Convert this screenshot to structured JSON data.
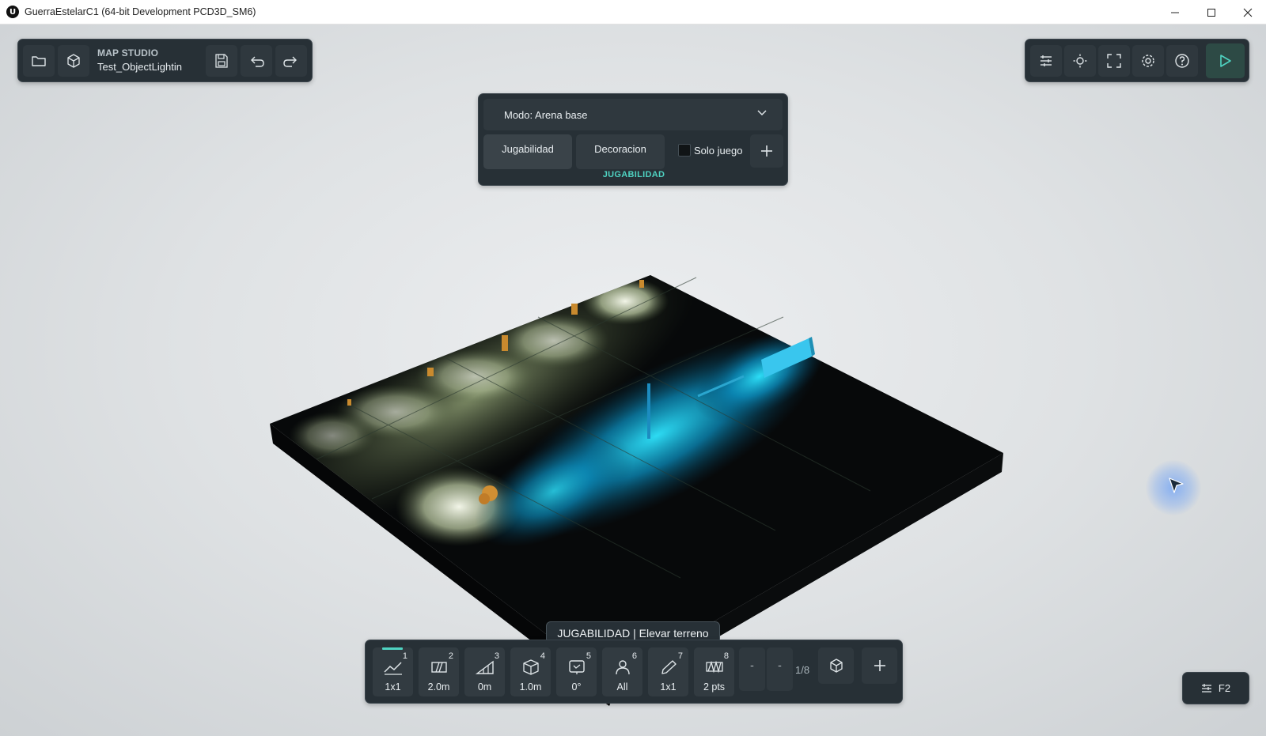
{
  "window": {
    "title": "GuerraEstelarC1 (64-bit Development PCD3D_SM6)",
    "logo_text": "U"
  },
  "header": {
    "studio_label": "MAP STUDIO",
    "map_name": "Test_ObjectLightin"
  },
  "mode_panel": {
    "mode_label": "Modo: Arena base",
    "tabs": [
      "Jugabilidad",
      "Decoracion"
    ],
    "active_tab": "Jugabilidad",
    "solo_label": "Solo juego",
    "solo_checked": false,
    "add_label": "+",
    "section": "JUGABILIDAD"
  },
  "tooltip": "JUGABILIDAD | Elevar terreno",
  "toolbar": {
    "tools": [
      {
        "num": "1",
        "value": "1x1",
        "icon": "terrain-raise-icon"
      },
      {
        "num": "2",
        "value": "2.0m",
        "icon": "brush-size-icon"
      },
      {
        "num": "3",
        "value": "0m",
        "icon": "ramp-icon"
      },
      {
        "num": "4",
        "value": "1.0m",
        "icon": "cube-icon"
      },
      {
        "num": "5",
        "value": "0°",
        "icon": "rotation-icon"
      },
      {
        "num": "6",
        "value": "All",
        "icon": "player-icon"
      },
      {
        "num": "7",
        "value": "1x1",
        "icon": "pencil-icon"
      },
      {
        "num": "8",
        "value": "2 pts",
        "icon": "points-icon"
      }
    ],
    "active_tool": 0,
    "prev_label": "ˉ",
    "next_label": "ˉ",
    "page": "1/8",
    "add_label": "+"
  },
  "f2_button": {
    "label": "F2"
  },
  "colors": {
    "accent": "#4fd3c2",
    "panel": "#273036",
    "button": "#2f383e",
    "play": "#2d4a45"
  }
}
